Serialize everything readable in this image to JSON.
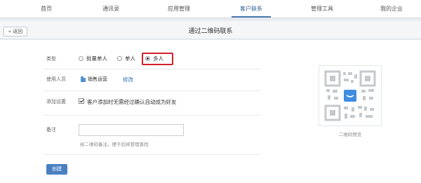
{
  "nav": {
    "tabs": [
      {
        "label": "首页",
        "active": false
      },
      {
        "label": "通讯录",
        "active": false
      },
      {
        "label": "应用管理",
        "active": false
      },
      {
        "label": "客户联系",
        "active": true
      },
      {
        "label": "管理工具",
        "active": false
      },
      {
        "label": "我的企业",
        "active": false
      }
    ]
  },
  "header": {
    "back_label": "« 返回",
    "title": "通过二维码联系"
  },
  "form": {
    "type_label": "类型",
    "type_options": [
      {
        "label": "批量单人",
        "checked": false
      },
      {
        "label": "单人",
        "checked": false
      },
      {
        "label": "多人",
        "checked": true
      }
    ],
    "user_label": "使用人员",
    "user_value": "销售运营",
    "modify_link": "修改",
    "add_settings_label": "添加设置",
    "auto_add_text": "客户添加时无需经过确认自动成为好友",
    "auto_add_checked": true,
    "remark_label": "备注",
    "remark_value": "",
    "remark_hint": "给二维码备注，便于后续管理查找",
    "create_button": "创建"
  },
  "preview": {
    "caption": "二维码预览"
  },
  "colors": {
    "accent": "#4a7fc1",
    "highlight": "#d0202a"
  }
}
